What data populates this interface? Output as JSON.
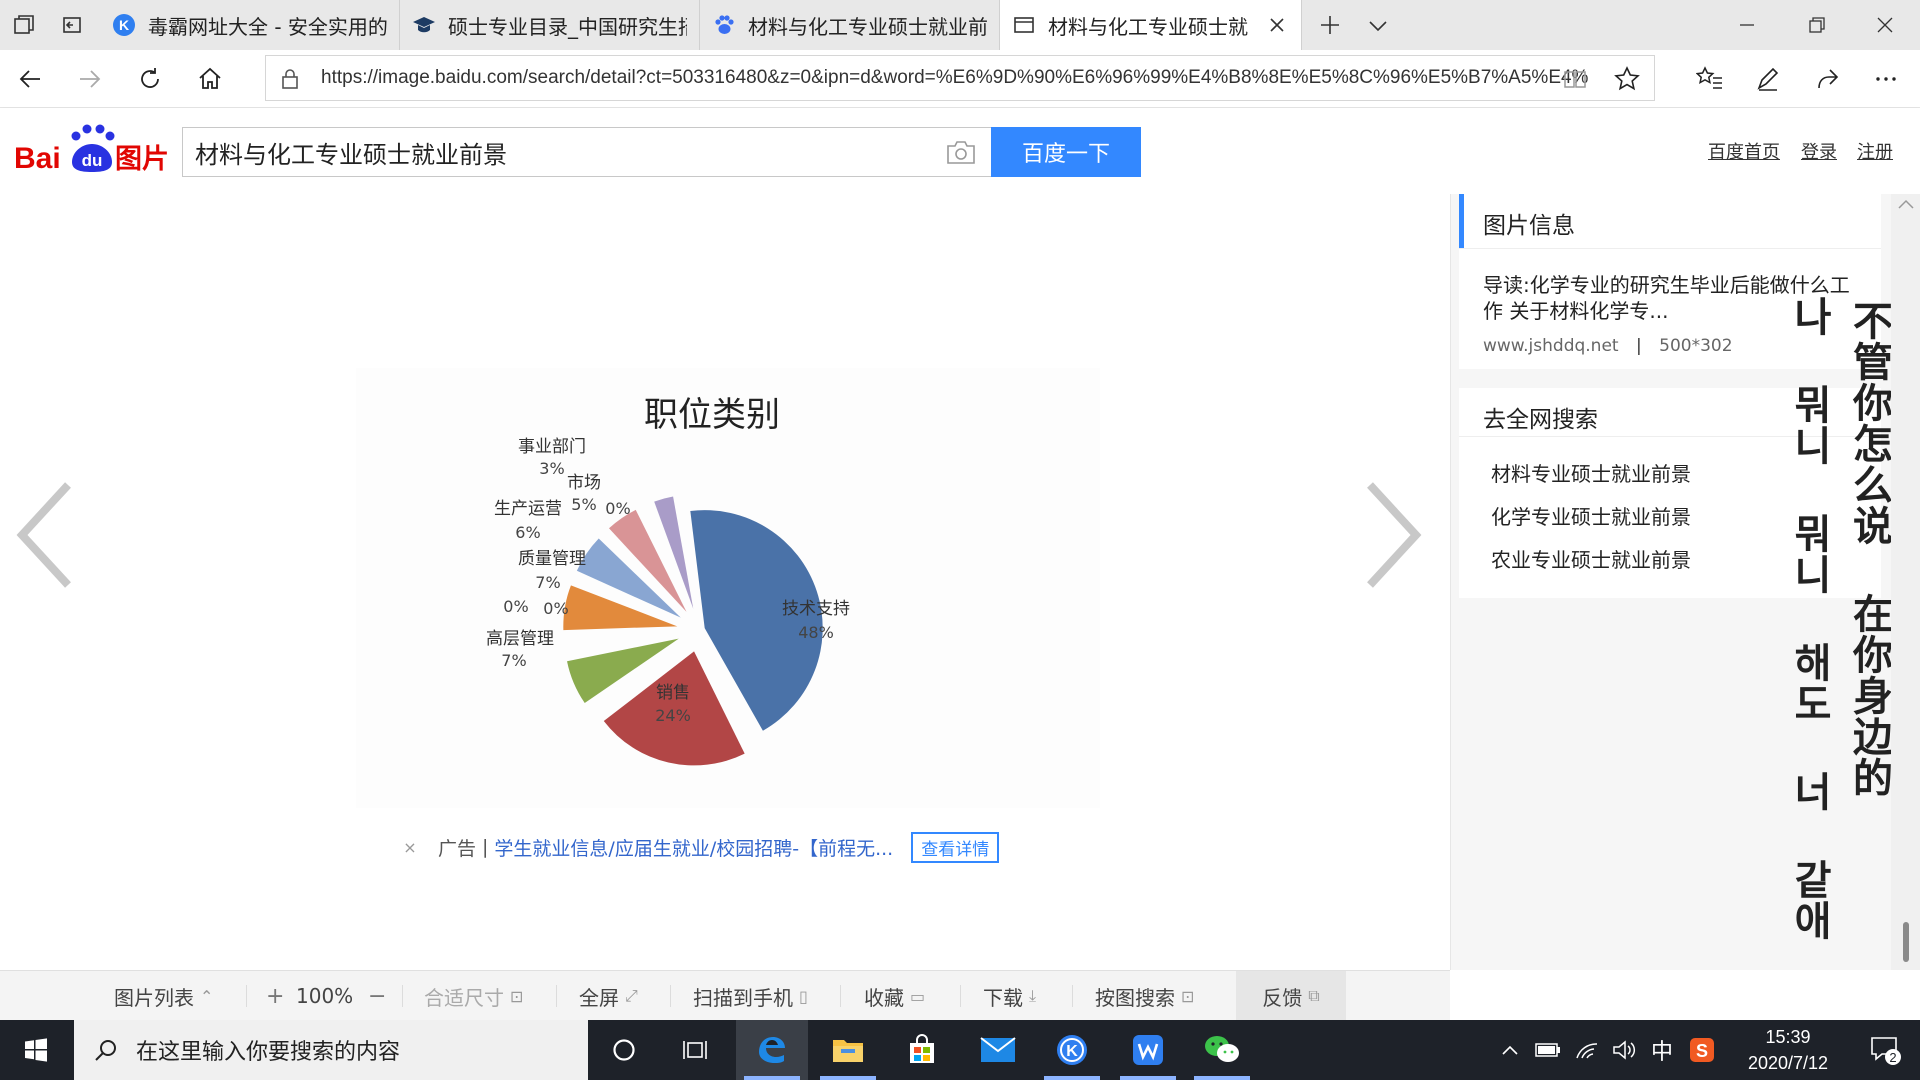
{
  "browser": {
    "tabs": [
      {
        "title": "毒霸网址大全 - 安全实用的",
        "icon": "kingsoft-k-icon"
      },
      {
        "title": "硕士专业目录_中国研究生招",
        "icon": "graduation-cap-icon"
      },
      {
        "title": "材料与化工专业硕士就业前",
        "icon": "baidu-paw-icon"
      },
      {
        "title": "材料与化工专业硕士就",
        "icon": "page-icon",
        "active": true
      }
    ],
    "url": "https://image.baidu.com/search/detail?ct=503316480&z=0&ipn=d&word=%E6%9D%90%E6%96%99%E4%B8%8E%E5%8C%96%E5%B7%A5%E4%"
  },
  "header": {
    "logo_text_bai": "Bai",
    "logo_text_du": "du",
    "logo_text_img": "图片",
    "search_value": "材料与化工专业硕士就业前景",
    "search_button": "百度一下",
    "links": [
      "百度首页",
      "登录",
      "注册"
    ]
  },
  "chart_data": {
    "type": "pie",
    "title": "职位类别",
    "slices": [
      {
        "label": "技术支持",
        "value": 48,
        "text": "48%",
        "color": "#4a72a8"
      },
      {
        "label": "销售",
        "value": 24,
        "text": "24%",
        "color": "#b24646"
      },
      {
        "label": "高层管理",
        "value": 7,
        "text": "7%",
        "color": "#8aab4e"
      },
      {
        "label": "",
        "value": 0,
        "text": "0%",
        "color": "#8aab4e"
      },
      {
        "label": "",
        "value": 0,
        "text": "0%",
        "color": "#8aab4e"
      },
      {
        "label": "质量管理",
        "value": 7,
        "text": "7%",
        "color": "#e28a3c"
      },
      {
        "label": "生产运营",
        "value": 6,
        "text": "6%",
        "color": "#89a6d2"
      },
      {
        "label": "市场",
        "value": 5,
        "text": "5%",
        "color": "#d99496"
      },
      {
        "label": "",
        "value": 0,
        "text": "0%",
        "color": "#d99496"
      },
      {
        "label": "事业部门",
        "value": 3,
        "text": "3%",
        "color": "#a99cc8"
      }
    ]
  },
  "ad": {
    "close": "×",
    "label": "广告",
    "sep": "|",
    "link": "学生就业信息/应届生就业/校园招聘-【前程无...",
    "button": "查看详情"
  },
  "sidebar": {
    "info_title": "图片信息",
    "info_desc": "导读:化学专业的研究生毕业后能做什么工作 关于材料化学专...",
    "info_source": "www.jshddq.net",
    "info_sep": "|",
    "info_size": "500*302",
    "search_title": "去全网搜索",
    "search_links": [
      "材料专业硕士就业前景",
      "化学专业硕士就业前景",
      "农业专业硕士就业前景"
    ]
  },
  "overlay": {
    "text_pink": "不管你怎么说 在你身边的",
    "text_red": "나 뭐니 뭐니 해도 너 같애",
    "color_pink": "#c8376a",
    "color_red": "#c8404e"
  },
  "toolbar": {
    "list": "图片列表",
    "zoom_in": "+",
    "zoom": "100%",
    "zoom_out": "−",
    "fit": "合适尺寸",
    "fullscreen": "全屏",
    "scan": "扫描到手机",
    "collect": "收藏",
    "download": "下载",
    "search_by_image": "按图搜索",
    "feedback": "反馈"
  },
  "taskbar": {
    "search_placeholder": "在这里输入你要搜索的内容",
    "ime": "中",
    "time": "15:39",
    "date": "2020/7/12",
    "notifications": "2"
  }
}
